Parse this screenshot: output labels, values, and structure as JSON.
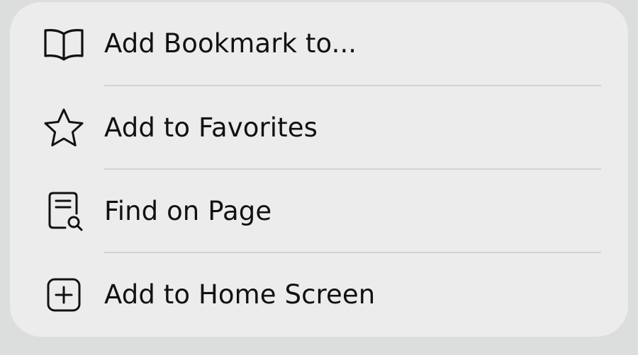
{
  "menu": {
    "items": [
      {
        "label": "Add Bookmark to...",
        "icon": "book-icon"
      },
      {
        "label": "Add to Favorites",
        "icon": "star-icon"
      },
      {
        "label": "Find on Page",
        "icon": "find-on-page-icon"
      },
      {
        "label": "Add to Home Screen",
        "icon": "plus-square-icon"
      }
    ]
  },
  "colors": {
    "background": "#dcdedd",
    "card": "#ececec",
    "text": "#111111",
    "divider": "#d3d3d3"
  }
}
